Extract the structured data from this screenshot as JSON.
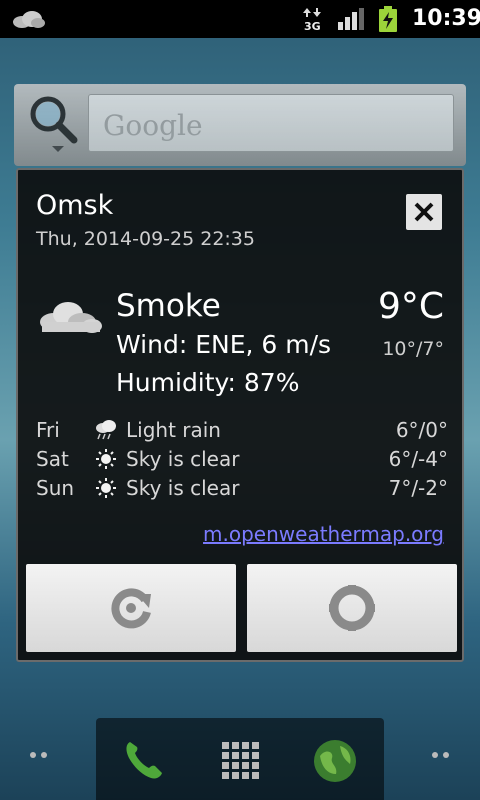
{
  "status_bar": {
    "notification_icon": "cloud-icon",
    "network": "3G",
    "time": "10:39"
  },
  "search_widget": {
    "placeholder": "Google"
  },
  "weather": {
    "city": "Omsk",
    "datetime": "Thu, 2014-09-25 22:35",
    "condition": "Smoke",
    "wind": "Wind: ENE, 6 m/s",
    "humidity": "Humidity: 87%",
    "temperature": "9°C",
    "range": "10°/7°",
    "forecast": [
      {
        "day": "Fri",
        "icon": "light-rain-icon",
        "description": "Light rain",
        "temps": "6°/0°"
      },
      {
        "day": "Sat",
        "icon": "clear-sky-icon",
        "description": "Sky is clear",
        "temps": "6°/-4°"
      },
      {
        "day": "Sun",
        "icon": "clear-sky-icon",
        "description": "Sky is clear",
        "temps": "7°/-2°"
      }
    ],
    "source_link": "m.openweathermap.org",
    "buttons": {
      "refresh_icon": "refresh-icon",
      "settings_icon": "settings-icon",
      "close_icon": "close-icon"
    }
  },
  "dock": {
    "items": [
      "phone-icon",
      "app-drawer-icon",
      "browser-icon"
    ]
  }
}
